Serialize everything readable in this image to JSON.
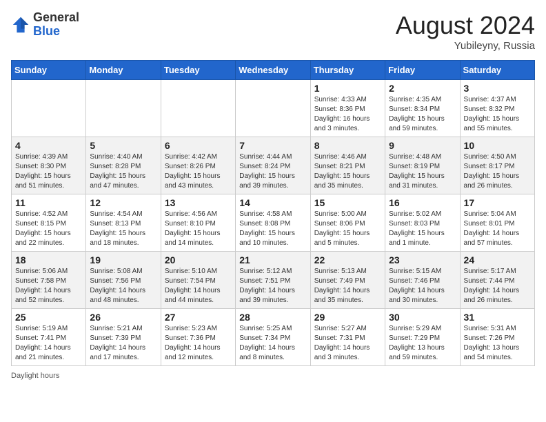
{
  "header": {
    "logo_general": "General",
    "logo_blue": "Blue",
    "month_year": "August 2024",
    "location": "Yubileyny, Russia"
  },
  "days_of_week": [
    "Sunday",
    "Monday",
    "Tuesday",
    "Wednesday",
    "Thursday",
    "Friday",
    "Saturday"
  ],
  "weeks": [
    [
      {
        "day": "",
        "info": ""
      },
      {
        "day": "",
        "info": ""
      },
      {
        "day": "",
        "info": ""
      },
      {
        "day": "",
        "info": ""
      },
      {
        "day": "1",
        "sunrise": "Sunrise: 4:33 AM",
        "sunset": "Sunset: 8:36 PM",
        "daylight": "Daylight: 16 hours and 3 minutes."
      },
      {
        "day": "2",
        "sunrise": "Sunrise: 4:35 AM",
        "sunset": "Sunset: 8:34 PM",
        "daylight": "Daylight: 15 hours and 59 minutes."
      },
      {
        "day": "3",
        "sunrise": "Sunrise: 4:37 AM",
        "sunset": "Sunset: 8:32 PM",
        "daylight": "Daylight: 15 hours and 55 minutes."
      }
    ],
    [
      {
        "day": "4",
        "sunrise": "Sunrise: 4:39 AM",
        "sunset": "Sunset: 8:30 PM",
        "daylight": "Daylight: 15 hours and 51 minutes."
      },
      {
        "day": "5",
        "sunrise": "Sunrise: 4:40 AM",
        "sunset": "Sunset: 8:28 PM",
        "daylight": "Daylight: 15 hours and 47 minutes."
      },
      {
        "day": "6",
        "sunrise": "Sunrise: 4:42 AM",
        "sunset": "Sunset: 8:26 PM",
        "daylight": "Daylight: 15 hours and 43 minutes."
      },
      {
        "day": "7",
        "sunrise": "Sunrise: 4:44 AM",
        "sunset": "Sunset: 8:24 PM",
        "daylight": "Daylight: 15 hours and 39 minutes."
      },
      {
        "day": "8",
        "sunrise": "Sunrise: 4:46 AM",
        "sunset": "Sunset: 8:21 PM",
        "daylight": "Daylight: 15 hours and 35 minutes."
      },
      {
        "day": "9",
        "sunrise": "Sunrise: 4:48 AM",
        "sunset": "Sunset: 8:19 PM",
        "daylight": "Daylight: 15 hours and 31 minutes."
      },
      {
        "day": "10",
        "sunrise": "Sunrise: 4:50 AM",
        "sunset": "Sunset: 8:17 PM",
        "daylight": "Daylight: 15 hours and 26 minutes."
      }
    ],
    [
      {
        "day": "11",
        "sunrise": "Sunrise: 4:52 AM",
        "sunset": "Sunset: 8:15 PM",
        "daylight": "Daylight: 15 hours and 22 minutes."
      },
      {
        "day": "12",
        "sunrise": "Sunrise: 4:54 AM",
        "sunset": "Sunset: 8:13 PM",
        "daylight": "Daylight: 15 hours and 18 minutes."
      },
      {
        "day": "13",
        "sunrise": "Sunrise: 4:56 AM",
        "sunset": "Sunset: 8:10 PM",
        "daylight": "Daylight: 15 hours and 14 minutes."
      },
      {
        "day": "14",
        "sunrise": "Sunrise: 4:58 AM",
        "sunset": "Sunset: 8:08 PM",
        "daylight": "Daylight: 15 hours and 10 minutes."
      },
      {
        "day": "15",
        "sunrise": "Sunrise: 5:00 AM",
        "sunset": "Sunset: 8:06 PM",
        "daylight": "Daylight: 15 hours and 5 minutes."
      },
      {
        "day": "16",
        "sunrise": "Sunrise: 5:02 AM",
        "sunset": "Sunset: 8:03 PM",
        "daylight": "Daylight: 15 hours and 1 minute."
      },
      {
        "day": "17",
        "sunrise": "Sunrise: 5:04 AM",
        "sunset": "Sunset: 8:01 PM",
        "daylight": "Daylight: 14 hours and 57 minutes."
      }
    ],
    [
      {
        "day": "18",
        "sunrise": "Sunrise: 5:06 AM",
        "sunset": "Sunset: 7:58 PM",
        "daylight": "Daylight: 14 hours and 52 minutes."
      },
      {
        "day": "19",
        "sunrise": "Sunrise: 5:08 AM",
        "sunset": "Sunset: 7:56 PM",
        "daylight": "Daylight: 14 hours and 48 minutes."
      },
      {
        "day": "20",
        "sunrise": "Sunrise: 5:10 AM",
        "sunset": "Sunset: 7:54 PM",
        "daylight": "Daylight: 14 hours and 44 minutes."
      },
      {
        "day": "21",
        "sunrise": "Sunrise: 5:12 AM",
        "sunset": "Sunset: 7:51 PM",
        "daylight": "Daylight: 14 hours and 39 minutes."
      },
      {
        "day": "22",
        "sunrise": "Sunrise: 5:13 AM",
        "sunset": "Sunset: 7:49 PM",
        "daylight": "Daylight: 14 hours and 35 minutes."
      },
      {
        "day": "23",
        "sunrise": "Sunrise: 5:15 AM",
        "sunset": "Sunset: 7:46 PM",
        "daylight": "Daylight: 14 hours and 30 minutes."
      },
      {
        "day": "24",
        "sunrise": "Sunrise: 5:17 AM",
        "sunset": "Sunset: 7:44 PM",
        "daylight": "Daylight: 14 hours and 26 minutes."
      }
    ],
    [
      {
        "day": "25",
        "sunrise": "Sunrise: 5:19 AM",
        "sunset": "Sunset: 7:41 PM",
        "daylight": "Daylight: 14 hours and 21 minutes."
      },
      {
        "day": "26",
        "sunrise": "Sunrise: 5:21 AM",
        "sunset": "Sunset: 7:39 PM",
        "daylight": "Daylight: 14 hours and 17 minutes."
      },
      {
        "day": "27",
        "sunrise": "Sunrise: 5:23 AM",
        "sunset": "Sunset: 7:36 PM",
        "daylight": "Daylight: 14 hours and 12 minutes."
      },
      {
        "day": "28",
        "sunrise": "Sunrise: 5:25 AM",
        "sunset": "Sunset: 7:34 PM",
        "daylight": "Daylight: 14 hours and 8 minutes."
      },
      {
        "day": "29",
        "sunrise": "Sunrise: 5:27 AM",
        "sunset": "Sunset: 7:31 PM",
        "daylight": "Daylight: 14 hours and 3 minutes."
      },
      {
        "day": "30",
        "sunrise": "Sunrise: 5:29 AM",
        "sunset": "Sunset: 7:29 PM",
        "daylight": "Daylight: 13 hours and 59 minutes."
      },
      {
        "day": "31",
        "sunrise": "Sunrise: 5:31 AM",
        "sunset": "Sunset: 7:26 PM",
        "daylight": "Daylight: 13 hours and 54 minutes."
      }
    ]
  ],
  "footer": {
    "daylight_label": "Daylight hours"
  }
}
